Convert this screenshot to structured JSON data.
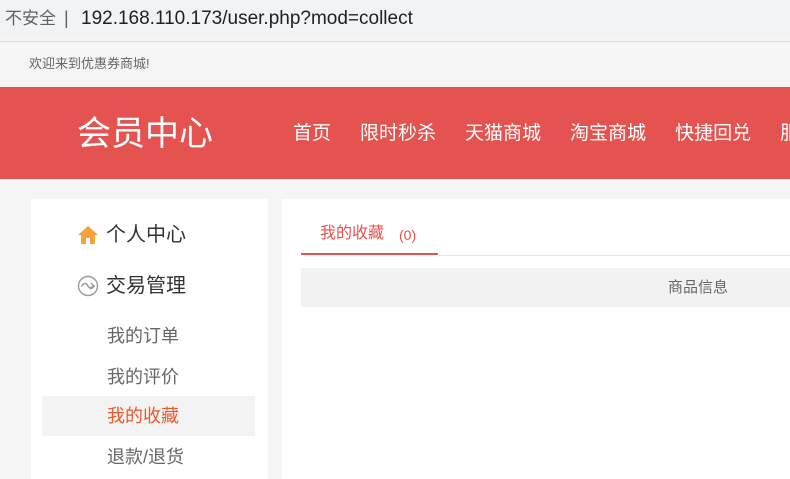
{
  "browser": {
    "security_label": "不安全",
    "separator": "|",
    "url": "192.168.110.173/user.php?mod=collect"
  },
  "topbar": {
    "welcome": "欢迎来到优惠券商城!"
  },
  "header": {
    "title": "会员中心",
    "nav": [
      "首页",
      "限时秒杀",
      "天猫商城",
      "淘宝商城",
      "快捷回兑",
      "服"
    ]
  },
  "sidebar": {
    "sections": [
      {
        "label": "个人中心",
        "icon": "home-icon"
      },
      {
        "label": "交易管理",
        "icon": "exchange-icon"
      }
    ],
    "links": [
      {
        "label": "我的订单",
        "active": false
      },
      {
        "label": "我的评价",
        "active": false
      },
      {
        "label": "我的收藏",
        "active": true
      },
      {
        "label": "退款/退货",
        "active": false
      }
    ]
  },
  "main": {
    "tab_label": "我的收藏",
    "tab_count": "(0)",
    "table_header": "商品信息"
  },
  "colors": {
    "header_bg": "#e4534f",
    "accent": "#e4534f",
    "active_link": "#ea5a2e",
    "home_icon": "#f6a23a",
    "page_bg": "#f5f5f5"
  }
}
